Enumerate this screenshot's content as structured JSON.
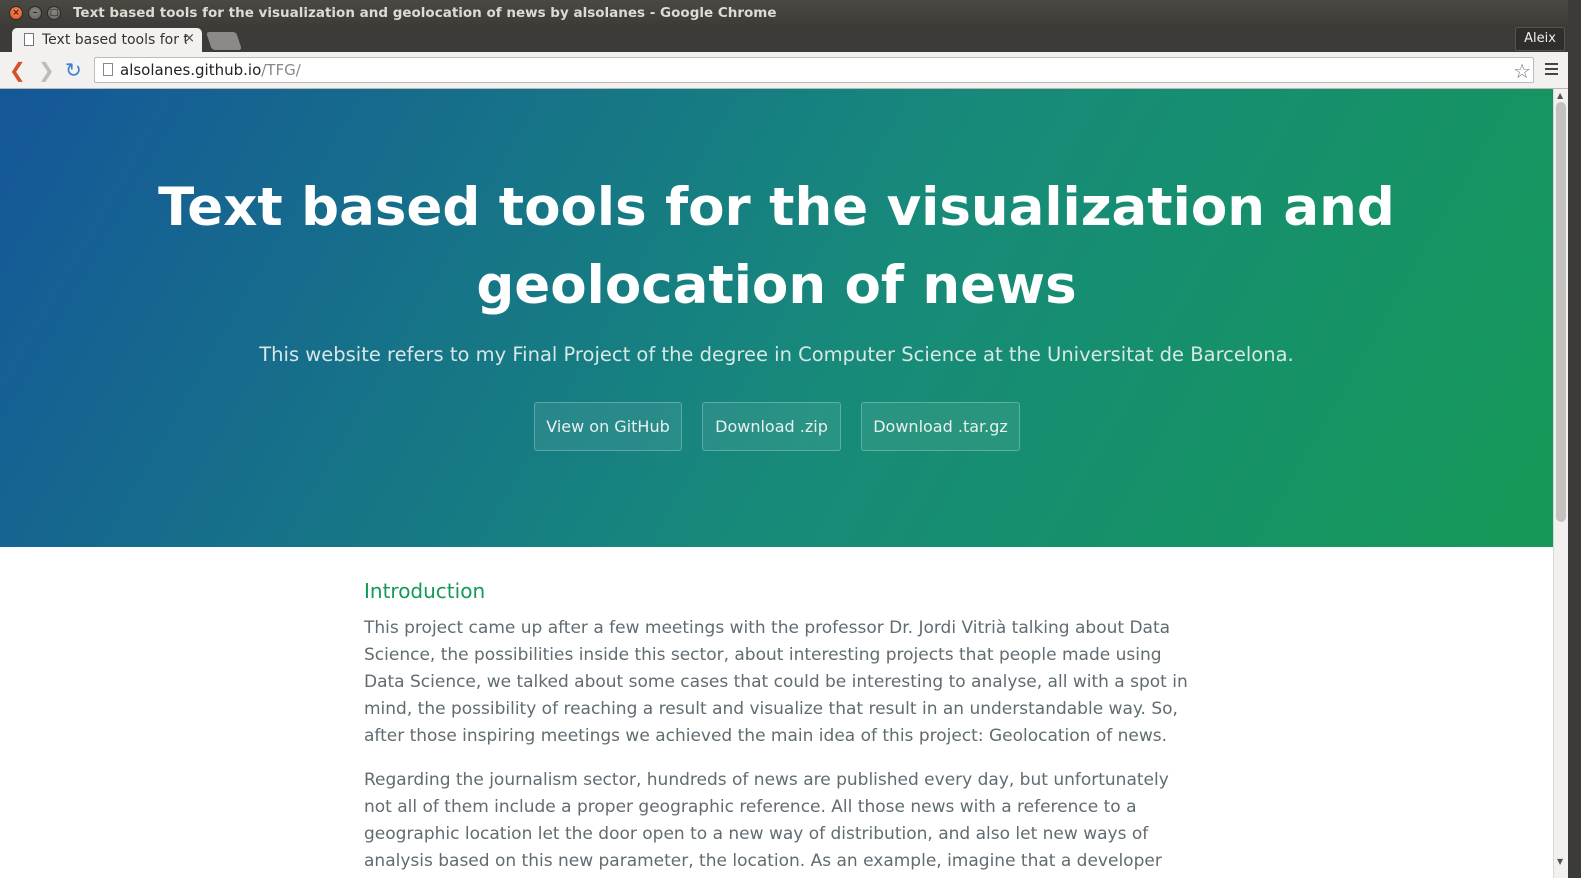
{
  "window": {
    "title": "Text based tools for the visualization and geolocation of news by alsolanes - Google Chrome",
    "close_glyph": "×",
    "min_glyph": "–",
    "max_glyph": "□"
  },
  "tab": {
    "label": "Text based tools for the visualization and geolocation of news by alsolanes",
    "close_glyph": "×"
  },
  "profile": {
    "name": "Aleix"
  },
  "toolbar": {
    "back_glyph": "❮",
    "forward_glyph": "❯",
    "reload_glyph": "↻",
    "url_host": "alsolanes.github.io",
    "url_path": "/TFG/",
    "star_glyph": "☆"
  },
  "hero": {
    "title_line1": "Text based tools for the visualization and",
    "title_line2": "geolocation of news",
    "tagline": "This website refers to my Final Project of the degree in Computer Science at the Universitat de Barcelona.",
    "buttons": [
      {
        "label": "View on GitHub"
      },
      {
        "label": "Download .zip"
      },
      {
        "label": "Download .tar.gz"
      }
    ]
  },
  "main": {
    "heading": "Introduction",
    "paragraph1": "This project came up after a few meetings with the professor Dr. Jordi Vitrià talking about Data Science, the possibilities inside this sector, about interesting projects that people made using Data Science, we talked about some cases that could be interesting to analyse, all with a spot in mind, the possibility of reaching a result and visualize that result in an understandable way. So, after those inspiring meetings we achieved the main idea of this project: Geolocation of news.",
    "paragraph2": "Regarding the journalism sector, hundreds of news are published every day, but unfortunately not all of them include a proper geographic reference. All those news with a reference to a geographic location let the door open to a new way of distribution, and also let new ways of analysis based on this new parameter, the location. As an example, imagine that a developer wants to let a user with a"
  },
  "scrollbar": {
    "up_glyph": "▲",
    "down_glyph": "▼"
  },
  "colors": {
    "hero_start": "#155799",
    "hero_end": "#159957",
    "heading": "#159957",
    "text": "#606c71"
  }
}
